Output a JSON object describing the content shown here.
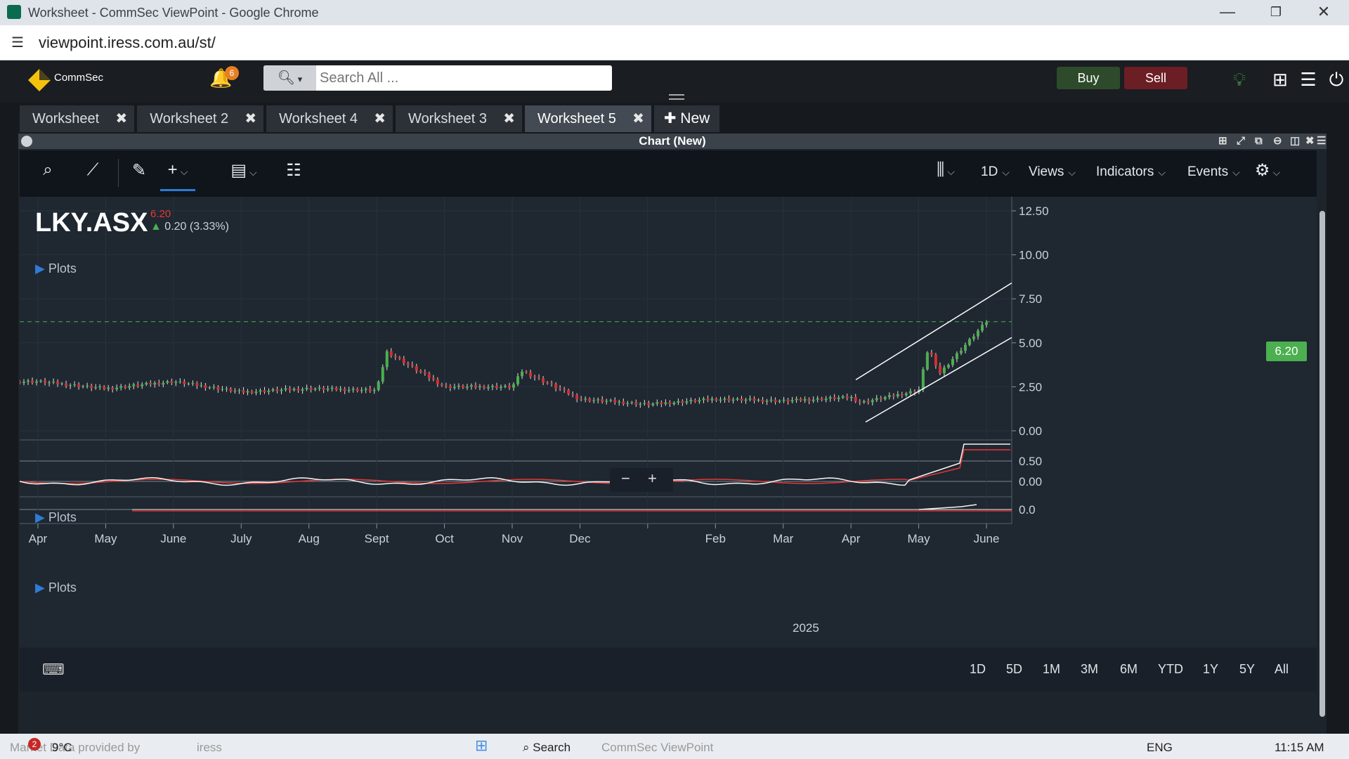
{
  "browser": {
    "window_title": "Worksheet - CommSec ViewPoint - Google Chrome",
    "url": "viewpoint.iress.com.au/st/"
  },
  "app": {
    "brand": "CommSec",
    "notifications_count": "6",
    "search_placeholder": "Search All ...",
    "buy_label": "Buy",
    "sell_label": "Sell",
    "tabs": [
      {
        "label": "Worksheet",
        "active": false
      },
      {
        "label": "Worksheet 2",
        "active": false
      },
      {
        "label": "Worksheet 4",
        "active": false
      },
      {
        "label": "Worksheet 3",
        "active": false
      },
      {
        "label": "Worksheet 5",
        "active": true
      }
    ],
    "new_tab_label": "New"
  },
  "chart_panel": {
    "title": "Chart (New)",
    "toolbar": {
      "interval": "1D",
      "views": "Views",
      "indicators": "Indicators",
      "events": "Events"
    },
    "ticker": "LKY.ASX",
    "last_price": "6.20",
    "change": "0.20 (3.33%)",
    "plots_label_1": "Plots",
    "plots_label_2": "Plots",
    "plots_label_3": "Plots",
    "zoom_minus": "−",
    "zoom_plus": "+",
    "price_tag": "6.20",
    "year_label": "2025",
    "ranges": [
      "1D",
      "5D",
      "1M",
      "3M",
      "6M",
      "YTD",
      "1Y",
      "5Y",
      "All"
    ],
    "colors": {
      "up": "#4caf50",
      "down": "#d32f2f",
      "price_tag": "#4caf50"
    }
  },
  "chart_data": {
    "type": "line",
    "ticker": "LKY.ASX",
    "x_ticks": [
      "Apr",
      "May",
      "June",
      "July",
      "Aug",
      "Sept",
      "Oct",
      "Nov",
      "Dec",
      "2025",
      "Feb",
      "Mar",
      "Apr",
      "May",
      "June"
    ],
    "y_ticks": [
      "12.50",
      "10.00",
      "7.50",
      "5.00",
      "2.50",
      "0.00"
    ],
    "ylim": [
      0,
      12.5
    ],
    "last_price": 6.2,
    "series": [
      {
        "name": "",
        "points": [
          [
            "Apr",
            2.8
          ],
          [
            "May",
            2.4
          ],
          [
            "June",
            2.8
          ],
          [
            "July",
            2.2
          ],
          [
            "Aug",
            2.4
          ],
          [
            "Sept",
            2.3
          ],
          [
            "Sept",
            4.5
          ],
          [
            "Oct",
            2.5
          ],
          [
            "Nov",
            2.5
          ],
          [
            "Nov",
            3.4
          ],
          [
            "Dec",
            1.8
          ],
          [
            "2025",
            1.5
          ],
          [
            "Feb",
            1.8
          ],
          [
            "Mar",
            1.7
          ],
          [
            "Apr",
            1.9
          ],
          [
            "Apr",
            1.6
          ],
          [
            "May",
            2.3
          ],
          [
            "May",
            4.8
          ],
          [
            "May",
            3.2
          ],
          [
            "June",
            6.2
          ]
        ]
      }
    ],
    "secondary_yticks_1": [
      "0.50",
      "0.00"
    ],
    "secondary_yticks_2": [
      "0.0"
    ]
  },
  "taskbar": {
    "weather": "9°C",
    "weather_alert": "2",
    "language": "ENG",
    "time": "11:15 AM",
    "search_text": "Search",
    "market_data": "Market Data provided by",
    "data_brand": "iress",
    "running_app": "CommSec ViewPoint"
  }
}
